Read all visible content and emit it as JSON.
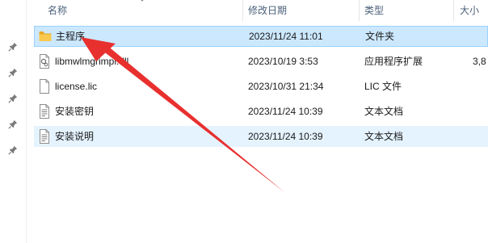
{
  "columns": {
    "name": "名称",
    "date": "修改日期",
    "type": "类型",
    "size": "大小"
  },
  "files": [
    {
      "name": "主程序",
      "date": "2023/11/24 11:01",
      "type": "文件夹",
      "size": "",
      "icon": "folder-icon",
      "state": "selected"
    },
    {
      "name": "libmwlmgrimpl.dll",
      "date": "2023/10/19 3:53",
      "type": "应用程序扩展",
      "size": "3,8",
      "icon": "dll-file-icon",
      "state": "normal"
    },
    {
      "name": "license.lic",
      "date": "2023/10/31 21:34",
      "type": "LIC 文件",
      "size": "",
      "icon": "blank-file-icon",
      "state": "normal"
    },
    {
      "name": "安装密钥",
      "date": "2023/11/24 10:39",
      "type": "文本文档",
      "size": "",
      "icon": "text-file-icon",
      "state": "normal"
    },
    {
      "name": "安装说明",
      "date": "2023/11/24 10:39",
      "type": "文本文档",
      "size": "",
      "icon": "text-file-icon",
      "state": "hovered"
    }
  ],
  "pins": [
    "pin-icon",
    "pin-icon",
    "pin-icon",
    "pin-icon",
    "pin-icon"
  ],
  "colors": {
    "selection_bg": "#cce8ff",
    "selection_border": "#99d1ff",
    "hover_bg": "#e5f3ff",
    "header_text": "#4c607a",
    "folder": "#f5c542",
    "annotation_arrow": "#e8302f"
  },
  "annotation": {
    "type": "arrow",
    "points_to": "主程序"
  }
}
